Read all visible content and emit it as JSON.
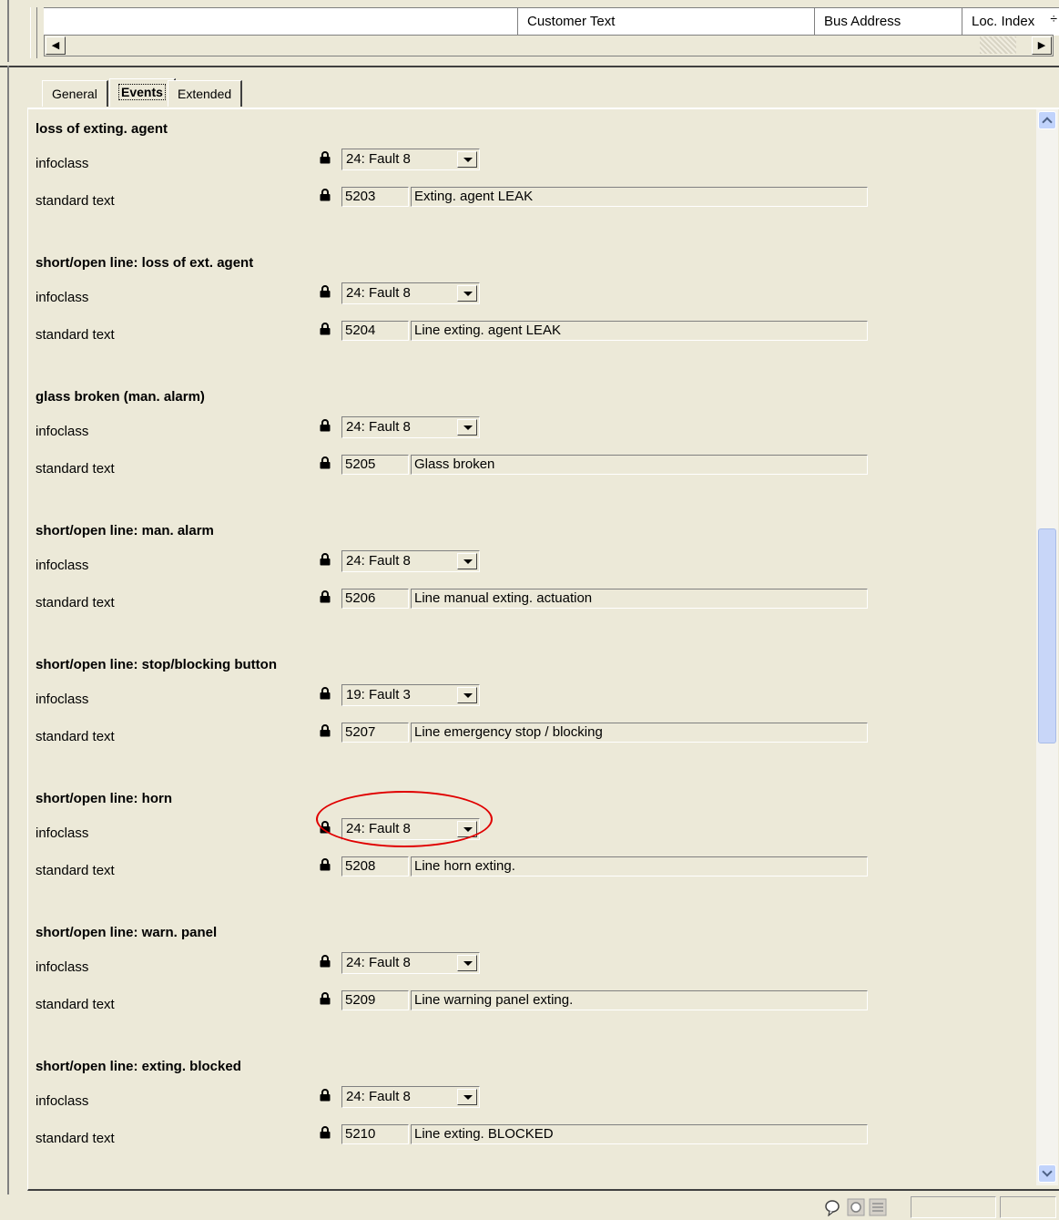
{
  "header": {
    "columns": [
      "Customer Text",
      "Bus Address",
      "Loc. Index"
    ]
  },
  "tabs": [
    {
      "label": "General",
      "active": false
    },
    {
      "label": "Events",
      "active": true
    },
    {
      "label": "Extended",
      "active": false
    }
  ],
  "labels": {
    "infoclass": "infoclass",
    "standard_text": "standard text"
  },
  "sections": [
    {
      "title": "loss of exting. agent",
      "infoclass": "24: Fault 8",
      "code": "5203",
      "text": "Exting. agent LEAK"
    },
    {
      "title": "short/open line: loss of ext. agent",
      "infoclass": "24: Fault 8",
      "code": "5204",
      "text": "Line exting. agent LEAK"
    },
    {
      "title": "glass broken (man. alarm)",
      "infoclass": "24: Fault 8",
      "code": "5205",
      "text": "Glass broken"
    },
    {
      "title": "short/open line: man. alarm",
      "infoclass": "24: Fault 8",
      "code": "5206",
      "text": "Line manual exting. actuation"
    },
    {
      "title": "short/open line: stop/blocking button",
      "infoclass": "19: Fault 3",
      "code": "5207",
      "text": "Line emergency stop / blocking"
    },
    {
      "title": "short/open line: horn",
      "infoclass": "24: Fault 8",
      "code": "5208",
      "text": "Line horn exting.",
      "highlighted": true
    },
    {
      "title": "short/open line: warn. panel",
      "infoclass": "24: Fault 8",
      "code": "5209",
      "text": "Line warning panel exting."
    },
    {
      "title": "short/open line: exting. blocked",
      "infoclass": "24: Fault 8",
      "code": "5210",
      "text": "Line exting. BLOCKED"
    }
  ],
  "icons": {
    "lock": "lock-icon",
    "dropdown": "chevron-down-icon",
    "scroll_up": "scroll-up-icon",
    "scroll_down": "scroll-down-icon"
  },
  "colors": {
    "background": "#ece9d8",
    "highlight": "#e00000",
    "scroll_accent": "#c1d3fb"
  }
}
